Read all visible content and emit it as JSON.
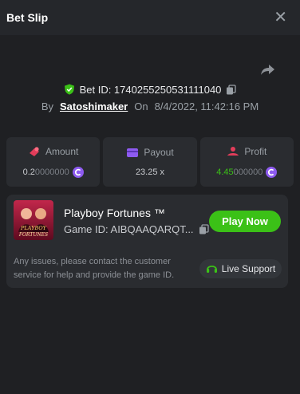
{
  "header": {
    "title": "Bet Slip",
    "close_glyph": "✕"
  },
  "bet": {
    "id_text": "Bet ID: 1740255250531111040",
    "by_label": "By",
    "username": "Satoshimaker",
    "on_label": "On",
    "datetime": "8/4/2022, 11:42:16 PM"
  },
  "stats": [
    {
      "label": "Amount",
      "value_main": "0.2",
      "value_zeros": "0000000",
      "icon": "amount-icon",
      "accent": "#e23d5a"
    },
    {
      "label": "Payout",
      "value_main": "23.25 x",
      "value_zeros": "",
      "icon": "payout-icon",
      "accent": "#8e5bf0"
    },
    {
      "label": "Profit",
      "value_main": "4.45",
      "value_zeros": "000000",
      "icon": "profit-icon",
      "accent": "#e23d5a"
    }
  ],
  "game": {
    "name": "Playboy Fortunes ™",
    "id_text": "Game ID: AIBQAAQARQT...",
    "play_label": "Play Now",
    "thumb_line1": "PLAYBOY",
    "thumb_line2": "FORTUNES"
  },
  "support": {
    "help_text": "Any issues, please contact the customer service for help and provide the game ID.",
    "button_label": "Live Support"
  },
  "colors": {
    "background": "#1f2023",
    "card": "#2a2c30",
    "accent_green": "#3bc117",
    "coin_purple": "#8e5bf0"
  }
}
